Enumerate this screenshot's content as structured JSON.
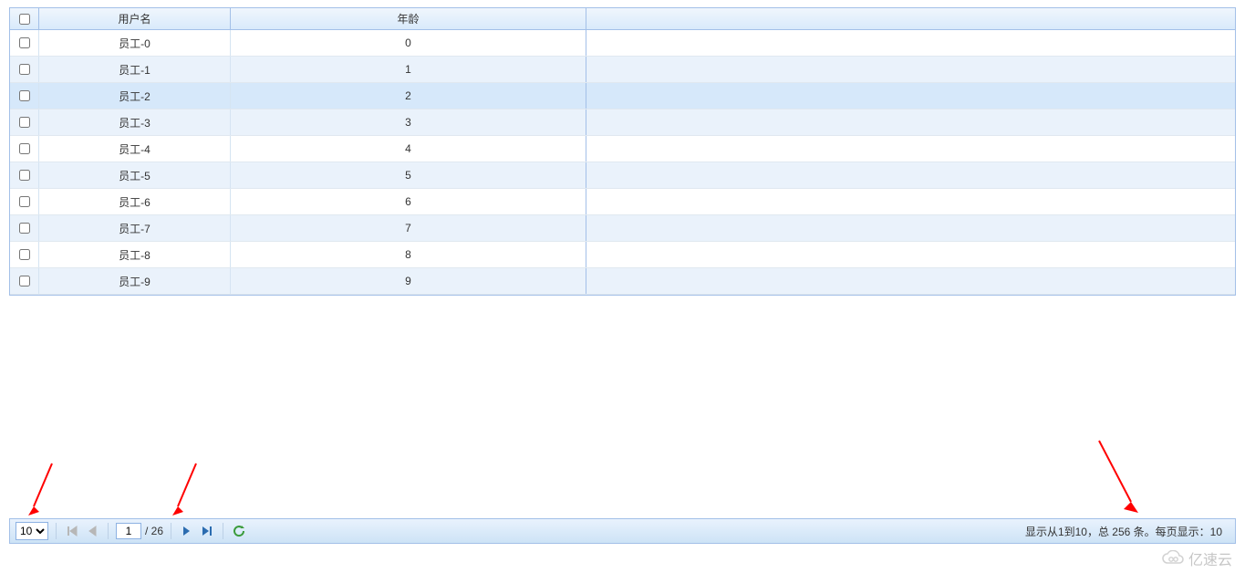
{
  "columns": {
    "checkbox": "",
    "username": "用户名",
    "age": "年龄"
  },
  "rows": [
    {
      "username": "员工-0",
      "age": "0",
      "selected": false
    },
    {
      "username": "员工-1",
      "age": "1",
      "selected": false
    },
    {
      "username": "员工-2",
      "age": "2",
      "selected": true
    },
    {
      "username": "员工-3",
      "age": "3",
      "selected": false
    },
    {
      "username": "员工-4",
      "age": "4",
      "selected": false
    },
    {
      "username": "员工-5",
      "age": "5",
      "selected": false
    },
    {
      "username": "员工-6",
      "age": "6",
      "selected": false
    },
    {
      "username": "员工-7",
      "age": "7",
      "selected": false
    },
    {
      "username": "员工-8",
      "age": "8",
      "selected": false
    },
    {
      "username": "员工-9",
      "age": "9",
      "selected": false
    }
  ],
  "pager": {
    "page_size_value": "10",
    "page_size_options": [
      "10"
    ],
    "current_page": "1",
    "total_pages_prefix": "/ ",
    "total_pages": "26",
    "info": "显示从1到10，总 256 条。每页显示：10"
  },
  "watermark": "亿速云"
}
